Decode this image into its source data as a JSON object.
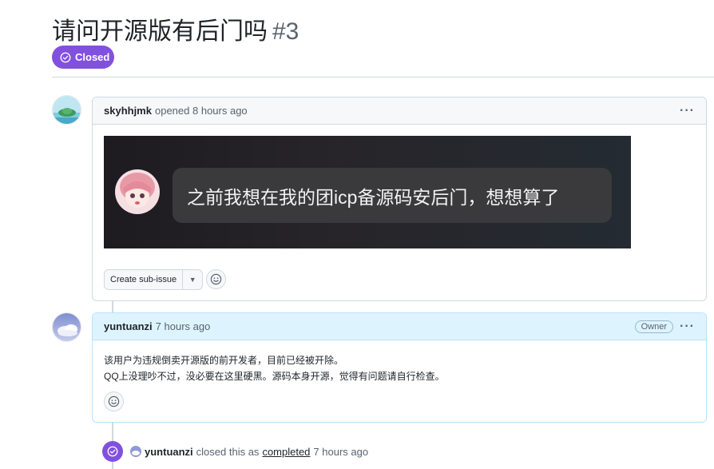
{
  "issue": {
    "title": "请问开源版有后门吗",
    "number": "#3",
    "state": "Closed"
  },
  "colors": {
    "closed_purple": "#8250df",
    "owner_header_bg": "#ddf4ff",
    "border": "#d1d9e0"
  },
  "comments": [
    {
      "author": "skyhhjmk",
      "action": "opened",
      "time": "8 hours ago",
      "image_caption": "之前我想在我的团icp备源码安后门，想想算了",
      "buttons": {
        "create_sub_issue": "Create sub-issue"
      }
    },
    {
      "author": "yuntuanzi",
      "time": "7 hours ago",
      "badge": "Owner",
      "body_lines": [
        "该用户为违规倒卖开源版的前开发者，目前已经被开除。",
        "QQ上没理吵不过，没必要在这里硬黑。源码本身开源，觉得有问题请自行检查。"
      ]
    }
  ],
  "event": {
    "author": "yuntuanzi",
    "text_before": "closed this as",
    "link": "completed",
    "time": "7 hours ago"
  },
  "icons": [
    "check-circle-icon",
    "kebab-icon",
    "smiley-icon",
    "caret-down-icon"
  ]
}
